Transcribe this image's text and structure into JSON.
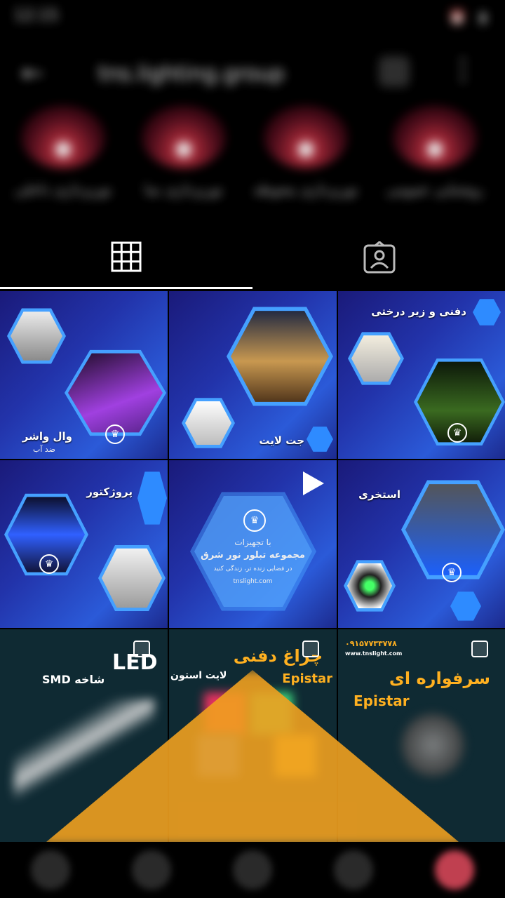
{
  "status_bar": {
    "time": "12:15",
    "icons": "⏰ ▮"
  },
  "header": {
    "username": "tns.lighting.group",
    "back_icon": "back-arrow-icon",
    "more_icon": "more-icon"
  },
  "highlights": [
    {
      "label": "نورپردازی داخلی"
    },
    {
      "label": "نورپردازی نما"
    },
    {
      "label": "نورپردازی محوطه"
    },
    {
      "label": "روشنایی عمومی"
    }
  ],
  "tabs": [
    {
      "name": "posts",
      "icon": "grid-icon",
      "active": true
    },
    {
      "name": "tagged",
      "icon": "tagged-person-icon",
      "active": false
    }
  ],
  "posts": [
    {
      "title": "وال واشر",
      "subtitle": "ضد آب"
    },
    {
      "title": "جت لایت"
    },
    {
      "title": "دفنی و زیر درختی"
    },
    {
      "title": "پروژکتور"
    },
    {
      "line1": "با تجهیزات",
      "line2": "مجموعه تبلور نور شرق",
      "line3": "در فضایی زنده تر، زندگی کنید",
      "website": "tnslight.com",
      "is_video": true
    },
    {
      "title": "استخری"
    },
    {
      "title": "LED",
      "subtitle": "شاخه SMD"
    },
    {
      "title": "چراغ دفنی",
      "subtitle": "لایت استون",
      "brand": "Epistar"
    },
    {
      "title": "سرفواره ای",
      "brand": "Epistar",
      "phone": "۰۹۱۵۷۷۳۳۷۷۸",
      "website": "www.tnslight.com"
    }
  ],
  "colors": {
    "background": "#000000",
    "post_blue": "#2b5ad8",
    "accent_orange": "#ffb020"
  }
}
